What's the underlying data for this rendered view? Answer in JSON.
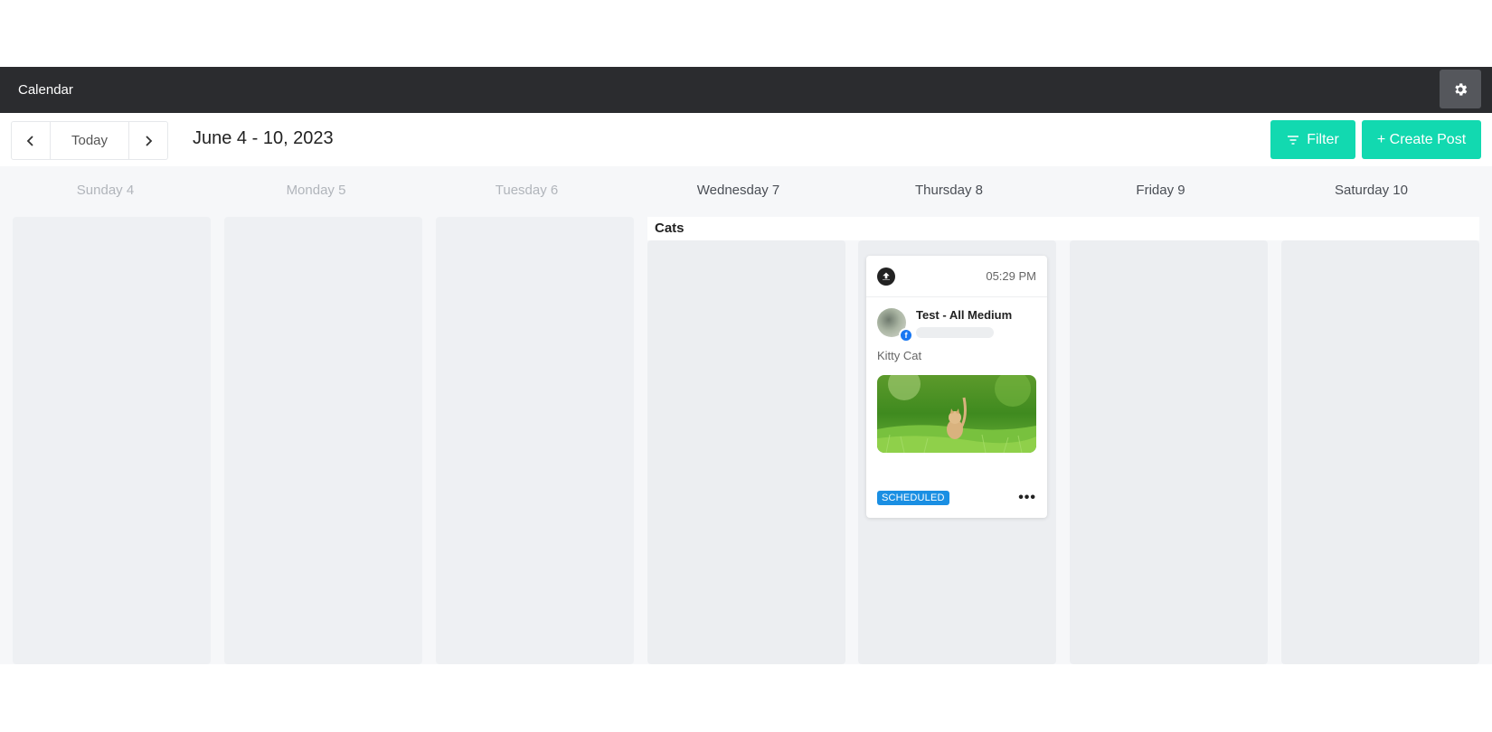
{
  "topbar": {
    "title": "Calendar",
    "settings_icon": "gear-icon"
  },
  "toolbar": {
    "prev_icon": "chevron-left-icon",
    "today_label": "Today",
    "next_icon": "chevron-right-icon",
    "date_range": "June 4 - 10, 2023",
    "filter_label": "Filter",
    "create_label": "+ Create Post"
  },
  "days": [
    {
      "label": "Sunday 4",
      "state": "past"
    },
    {
      "label": "Monday 5",
      "state": "past"
    },
    {
      "label": "Tuesday 6",
      "state": "past"
    },
    {
      "label": "Wednesday 7",
      "state": "current"
    },
    {
      "label": "Thursday 8",
      "state": "upcoming"
    },
    {
      "label": "Friday 9",
      "state": "upcoming"
    },
    {
      "label": "Saturday 10",
      "state": "upcoming"
    }
  ],
  "group": {
    "label": "Cats"
  },
  "post": {
    "time": "05:29 PM",
    "author": "Test - All Medium",
    "network": "facebook",
    "text": "Kitty Cat",
    "status": "SCHEDULED"
  },
  "colors": {
    "accent": "#12d9b0",
    "topbar": "#2b2c2f",
    "status": "#1a8fe3"
  }
}
